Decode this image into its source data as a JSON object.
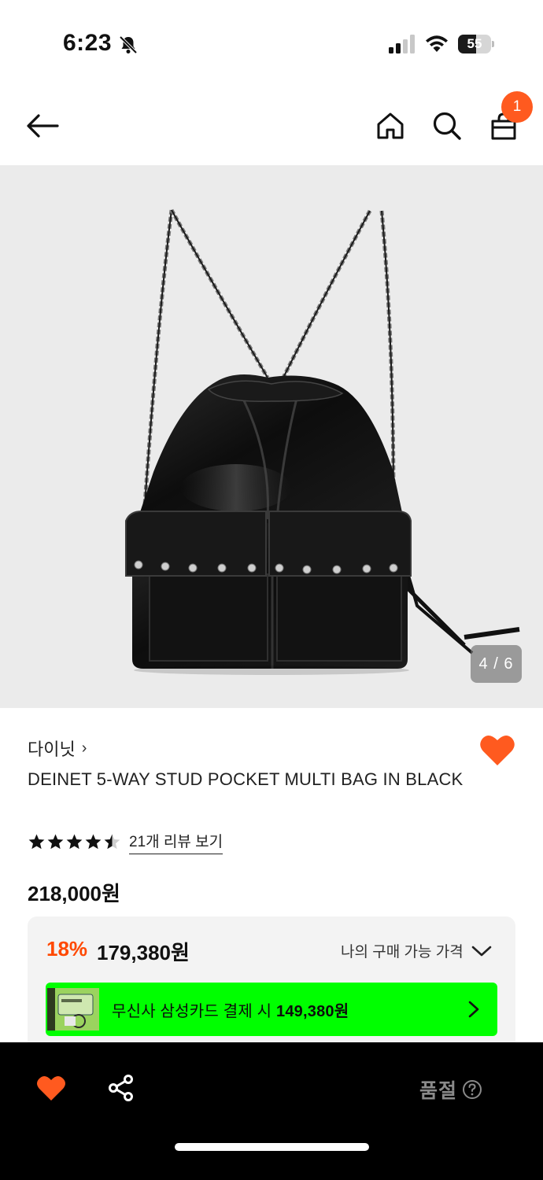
{
  "status_bar": {
    "time": "6:23",
    "battery_level": "55",
    "battery_fraction": 0.55
  },
  "header": {
    "cart_count": "1"
  },
  "gallery": {
    "counter": "4 / 6",
    "current_index": 4,
    "total": 6
  },
  "product": {
    "brand": "다이닛",
    "brand_chevron": "›",
    "name": "DEINET 5-WAY STUD POCKET MULTI BAG IN BLACK",
    "rating": 4.5,
    "review_link": "21개 리뷰 보기",
    "original_price": "218,000원",
    "liked": true
  },
  "pricing": {
    "discount_rate": "18%",
    "sale_price": "179,380원",
    "my_price_label": "나의 구매 가능 가격",
    "card_offer_prefix": "무신사 삼성카드 결제 시 ",
    "card_offer_price": "149,380원"
  },
  "bottom_bar": {
    "status_label": "품절"
  },
  "colors": {
    "accent": "#ff5a1f",
    "discount": "#ff4800",
    "card_banner": "#00ff00",
    "image_bg": "#ebebeb"
  },
  "icons": [
    "back-arrow-icon",
    "home-icon",
    "search-icon",
    "shopping-bag-icon",
    "heart-icon",
    "share-icon",
    "help-icon",
    "star-icon",
    "chevron-down-icon",
    "chevron-right-icon"
  ]
}
